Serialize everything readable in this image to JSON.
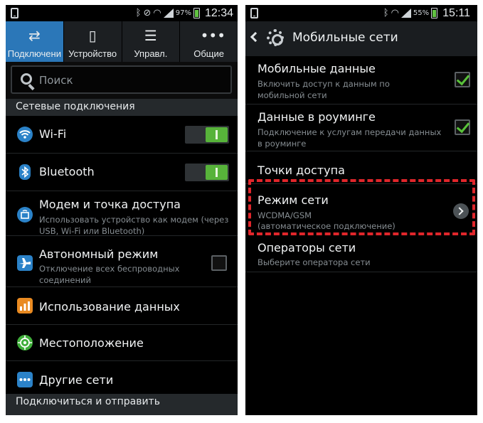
{
  "left_screen": {
    "status_bar": {
      "battery_percent": "97%",
      "time": "12:34"
    },
    "tabs": [
      {
        "label": "Подключени",
        "icon": "arrows-swap-icon",
        "active": true
      },
      {
        "label": "Устройство",
        "icon": "phone-icon",
        "active": false
      },
      {
        "label": "Управл.",
        "icon": "sliders-icon",
        "active": false
      },
      {
        "label": "Общие",
        "icon": "more-dots-icon",
        "active": false
      }
    ],
    "search": {
      "placeholder": "Поиск"
    },
    "section_network": "Сетевые подключения",
    "items": [
      {
        "title": "Wi-Fi",
        "subtitle": "",
        "icon": "wifi-icon",
        "control": "toggle-on"
      },
      {
        "title": "Bluetooth",
        "subtitle": "",
        "icon": "bluetooth-icon",
        "control": "toggle-on"
      },
      {
        "title": "Модем и точка доступа",
        "subtitle": "Использовать устройство как модем (через USB, Wi-Fi или Bluetooth)",
        "icon": "tethering-icon",
        "control": "none"
      },
      {
        "title": "Автономный режим",
        "subtitle": "Отключение всех беспроводных соединений",
        "icon": "airplane-icon",
        "control": "checkbox-off"
      },
      {
        "title": "Использование данных",
        "subtitle": "",
        "icon": "data-usage-icon",
        "control": "none"
      },
      {
        "title": "Местоположение",
        "subtitle": "",
        "icon": "location-icon",
        "control": "none"
      },
      {
        "title": "Другие сети",
        "subtitle": "",
        "icon": "more-networks-icon",
        "control": "none"
      }
    ],
    "section_connect": "Подключиться и отправить"
  },
  "right_screen": {
    "status_bar": {
      "battery_percent": "55%",
      "time": "15:11"
    },
    "appbar_title": "Мобильные сети",
    "items": [
      {
        "title": "Мобильные данные",
        "subtitle": "Включить доступ к данным по мобильной сети",
        "control": "checkbox-on"
      },
      {
        "title": "Данные в роуминге",
        "subtitle": "Подключение к услугам передачи данных в роуминге",
        "control": "checkbox-on"
      },
      {
        "title": "Точки доступа",
        "subtitle": "",
        "control": "none"
      },
      {
        "title": "Режим сети",
        "subtitle_line1": "WCDMA/GSM",
        "subtitle_line2": "(автоматическое подключение)",
        "control": "chevron"
      },
      {
        "title": "Операторы сети",
        "subtitle": "Выберите оператора сети",
        "control": "none"
      }
    ]
  },
  "colors": {
    "active_tab": "#2b77b8",
    "toggle_on": "#57b33a",
    "checkmark": "#59c23a",
    "highlight": "#e0262b"
  }
}
